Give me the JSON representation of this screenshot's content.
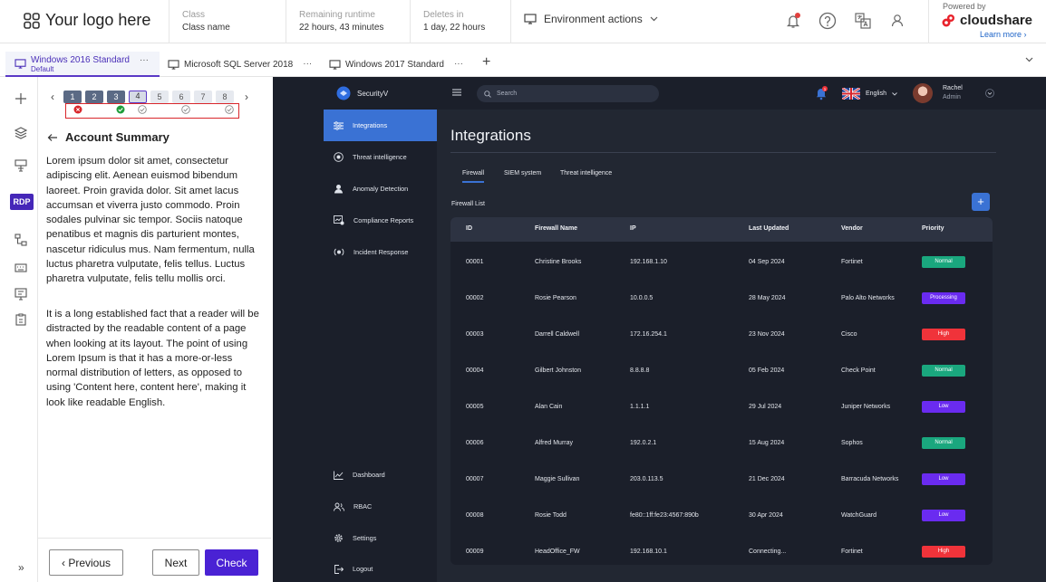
{
  "header": {
    "logo_text": "Your logo here",
    "class_label": "Class",
    "class_value": "Class name",
    "runtime_label": "Remaining runtime",
    "runtime_value": "22 hours, 43 minutes",
    "deletes_label": "Deletes in",
    "deletes_value": "1 day, 22 hours",
    "env_actions": "Environment actions",
    "powered_by": "Powered by",
    "brand": "cloudshare",
    "learn_more": "Learn more ›"
  },
  "vm_tabs": [
    {
      "label": "Windows 2016 Standard",
      "sub": "Default",
      "active": true
    },
    {
      "label": "Microsoft SQL Server 2018",
      "sub": "",
      "active": false
    },
    {
      "label": "Windows 2017 Standard",
      "sub": "",
      "active": false
    }
  ],
  "rail": {
    "rdp_label": "RDP"
  },
  "steps": {
    "numbers": [
      "1",
      "2",
      "3",
      "4",
      "5",
      "6",
      "7",
      "8"
    ],
    "current": 4,
    "prev_glyph": "‹",
    "next_glyph": "›"
  },
  "panel": {
    "title": "Account Summary",
    "paragraph1": "Lorem ipsum dolor sit amet, consectetur adipiscing elit. Aenean euismod bibendum laoreet. Proin gravida dolor. Sit amet lacus accumsan et viverra justo commodo. Proin sodales pulvinar sic tempor. Sociis natoque penatibus et magnis dis parturient montes, nascetur ridiculus mus. Nam fermentum, nulla luctus pharetra vulputate, felis tellus. Luctus pharetra vulputate, felis tellu mollis orci.",
    "paragraph2": "It is a long established fact that a reader will be distracted by the readable content of a page when looking at its layout. The point of using Lorem Ipsum is that it has a more-or-less normal distribution of letters, as opposed to using 'Content here, content here', making it look like readable English.",
    "previous_label": "‹  Previous",
    "next_label": "Next",
    "check_label": "Check",
    "expand_glyph": "»"
  },
  "app": {
    "name": "SecurityV",
    "search_placeholder": "Search",
    "language": "English",
    "user_name": "Rachel",
    "user_role": "Admin",
    "notification_count": "1",
    "nav": [
      "Integrations",
      "Threat intelligence",
      "Anomaly Detection",
      "Compliance Reports",
      "Incident Response"
    ],
    "nav_bottom": [
      "Dashboard",
      "RBAC",
      "Settings",
      "Logout"
    ],
    "page_title": "Integrations",
    "subtabs": [
      "Firewall",
      "SIEM system",
      "Threat intelligence"
    ],
    "list_title": "Firewall List",
    "add_glyph": "+",
    "columns": [
      "ID",
      "Firewall Name",
      "IP",
      "Last Updated",
      "Vendor",
      "Priority"
    ],
    "rows": [
      {
        "id": "00001",
        "name": "Christine Brooks",
        "ip": "192.168.1.10",
        "updated": "04 Sep 2024",
        "vendor": "Fortinet",
        "priority": "Normal"
      },
      {
        "id": "00002",
        "name": "Rosie Pearson",
        "ip": "10.0.0.5",
        "updated": "28 May 2024",
        "vendor": "Palo Alto Networks",
        "priority": "Processing"
      },
      {
        "id": "00003",
        "name": "Darrell Caldwell",
        "ip": "172.16.254.1",
        "updated": "23 Nov 2024",
        "vendor": "Cisco",
        "priority": "High"
      },
      {
        "id": "00004",
        "name": "Gilbert Johnston",
        "ip": "8.8.8.8",
        "updated": "05 Feb 2024",
        "vendor": "Check Point",
        "priority": "Normal"
      },
      {
        "id": "00005",
        "name": "Alan Cain",
        "ip": "1.1.1.1",
        "updated": "29 Jul 2024",
        "vendor": "Juniper Networks",
        "priority": "Low"
      },
      {
        "id": "00006",
        "name": "Alfred Murray",
        "ip": "192.0.2.1",
        "updated": "15 Aug 2024",
        "vendor": "Sophos",
        "priority": "Normal"
      },
      {
        "id": "00007",
        "name": "Maggie Sullivan",
        "ip": "203.0.113.5",
        "updated": "21 Dec 2024",
        "vendor": "Barracuda Networks",
        "priority": "Low"
      },
      {
        "id": "00008",
        "name": "Rosie Todd",
        "ip": "fe80::1ff:fe23:4567:890b",
        "updated": "30 Apr 2024",
        "vendor": "WatchGuard",
        "priority": "Low"
      },
      {
        "id": "00009",
        "name": "HeadOffice_FW",
        "ip": "192.168.10.1",
        "updated": "Connecting...",
        "vendor": "Fortinet",
        "priority": "High"
      }
    ],
    "priority_colors": {
      "Normal": "#1aa77e",
      "Processing": "#6a2bf0",
      "High": "#f0333a",
      "Low": "#6a2bf0"
    }
  },
  "colors": {
    "accent": "#4a22d4",
    "app_primary": "#3a72d4",
    "step_error": "#d9262b",
    "step_ok": "#1f9d3a"
  }
}
